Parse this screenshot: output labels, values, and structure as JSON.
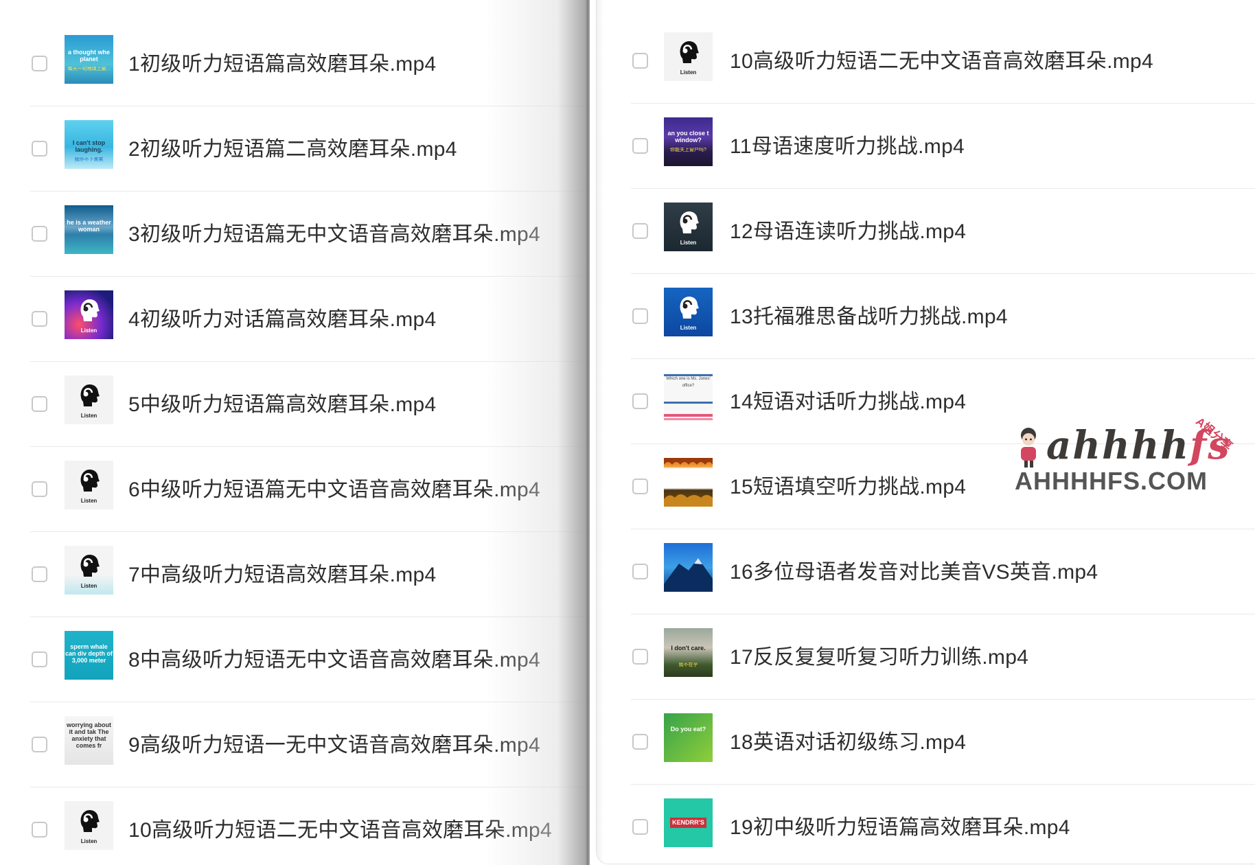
{
  "left_list": {
    "items": [
      {
        "name": "1初级听力短语篇高效磨耳朵.mp4",
        "thumb_text": "a thought whe planet",
        "thumb_sub": "每天一句地球上最..."
      },
      {
        "name": "2初级听力短语篇二高效磨耳朵.mp4",
        "thumb_text": "I can't stop laughing.",
        "thumb_sub": "我停不下来笑"
      },
      {
        "name": "3初级听力短语篇无中文语音高效磨耳朵.mp4",
        "thumb_text": "he is a weather woman",
        "thumb_sub": ""
      },
      {
        "name": "4初级听力对话篇高效磨耳朵.mp4",
        "thumb_text": "Listen",
        "thumb_sub": ""
      },
      {
        "name": "5中级听力短语篇高效磨耳朵.mp4",
        "thumb_text": "Listen",
        "thumb_sub": ""
      },
      {
        "name": "6中级听力短语篇无中文语音高效磨耳朵.mp4",
        "thumb_text": "Listen",
        "thumb_sub": ""
      },
      {
        "name": "7中高级听力短语高效磨耳朵.mp4",
        "thumb_text": "Listen",
        "thumb_sub": ""
      },
      {
        "name": "8中高级听力短语无中文语音高效磨耳朵.mp4",
        "thumb_text": "sperm whale can div depth of 3,000 meter",
        "thumb_sub": ""
      },
      {
        "name": "9高级听力短语一无中文语音高效磨耳朵.mp4",
        "thumb_text": "worrying about it and tak The anxiety that comes fr",
        "thumb_sub": ""
      },
      {
        "name": "10高级听力短语二无中文语音高效磨耳朵.mp4",
        "thumb_text": "Listen",
        "thumb_sub": ""
      }
    ]
  },
  "right_list": {
    "items": [
      {
        "name": "10高级听力短语二无中文语音高效磨耳朵.mp4",
        "thumb_text": "Listen",
        "thumb_sub": ""
      },
      {
        "name": "11母语速度听力挑战.mp4",
        "thumb_text": "an you close t window?",
        "thumb_sub": "你能关上窗户吗?"
      },
      {
        "name": "12母语连读听力挑战.mp4",
        "thumb_text": "Listen",
        "thumb_sub": ""
      },
      {
        "name": "13托福雅思备战听力挑战.mp4",
        "thumb_text": "Listen",
        "thumb_sub": ""
      },
      {
        "name": "14短语对话听力挑战.mp4",
        "thumb_text": "Which one is Ms. Jones' office?",
        "thumb_sub": ""
      },
      {
        "name": "15短语填空听力挑战.mp4",
        "thumb_text": "",
        "thumb_sub": ""
      },
      {
        "name": "16多位母语者发音对比美音VS英音.mp4",
        "thumb_text": "",
        "thumb_sub": ""
      },
      {
        "name": "17反反复复听复习听力训练.mp4",
        "thumb_text": "I don't care.",
        "thumb_sub": "我不在乎"
      },
      {
        "name": "18英语对话初级练习.mp4",
        "thumb_text": "Do you eat?",
        "thumb_sub": ""
      },
      {
        "name": "19初中级听力短语篇高效磨耳朵.mp4",
        "thumb_text": "KENDRR'S",
        "thumb_sub": ""
      }
    ]
  },
  "watermark": {
    "script": "ahhhhfs",
    "domain": "AHHHHFS.COM",
    "badge": "A姐分享"
  },
  "colors": {
    "filename_text": "#2d2d2d",
    "checkbox_border": "#c8c8c8",
    "row_divider": "#e9e9e9",
    "watermark_accent": "#d2465f",
    "watermark_gray": "#555555"
  },
  "icons": {
    "listen": "listen-head-headphones-icon",
    "checkbox": "checkbox-icon"
  }
}
